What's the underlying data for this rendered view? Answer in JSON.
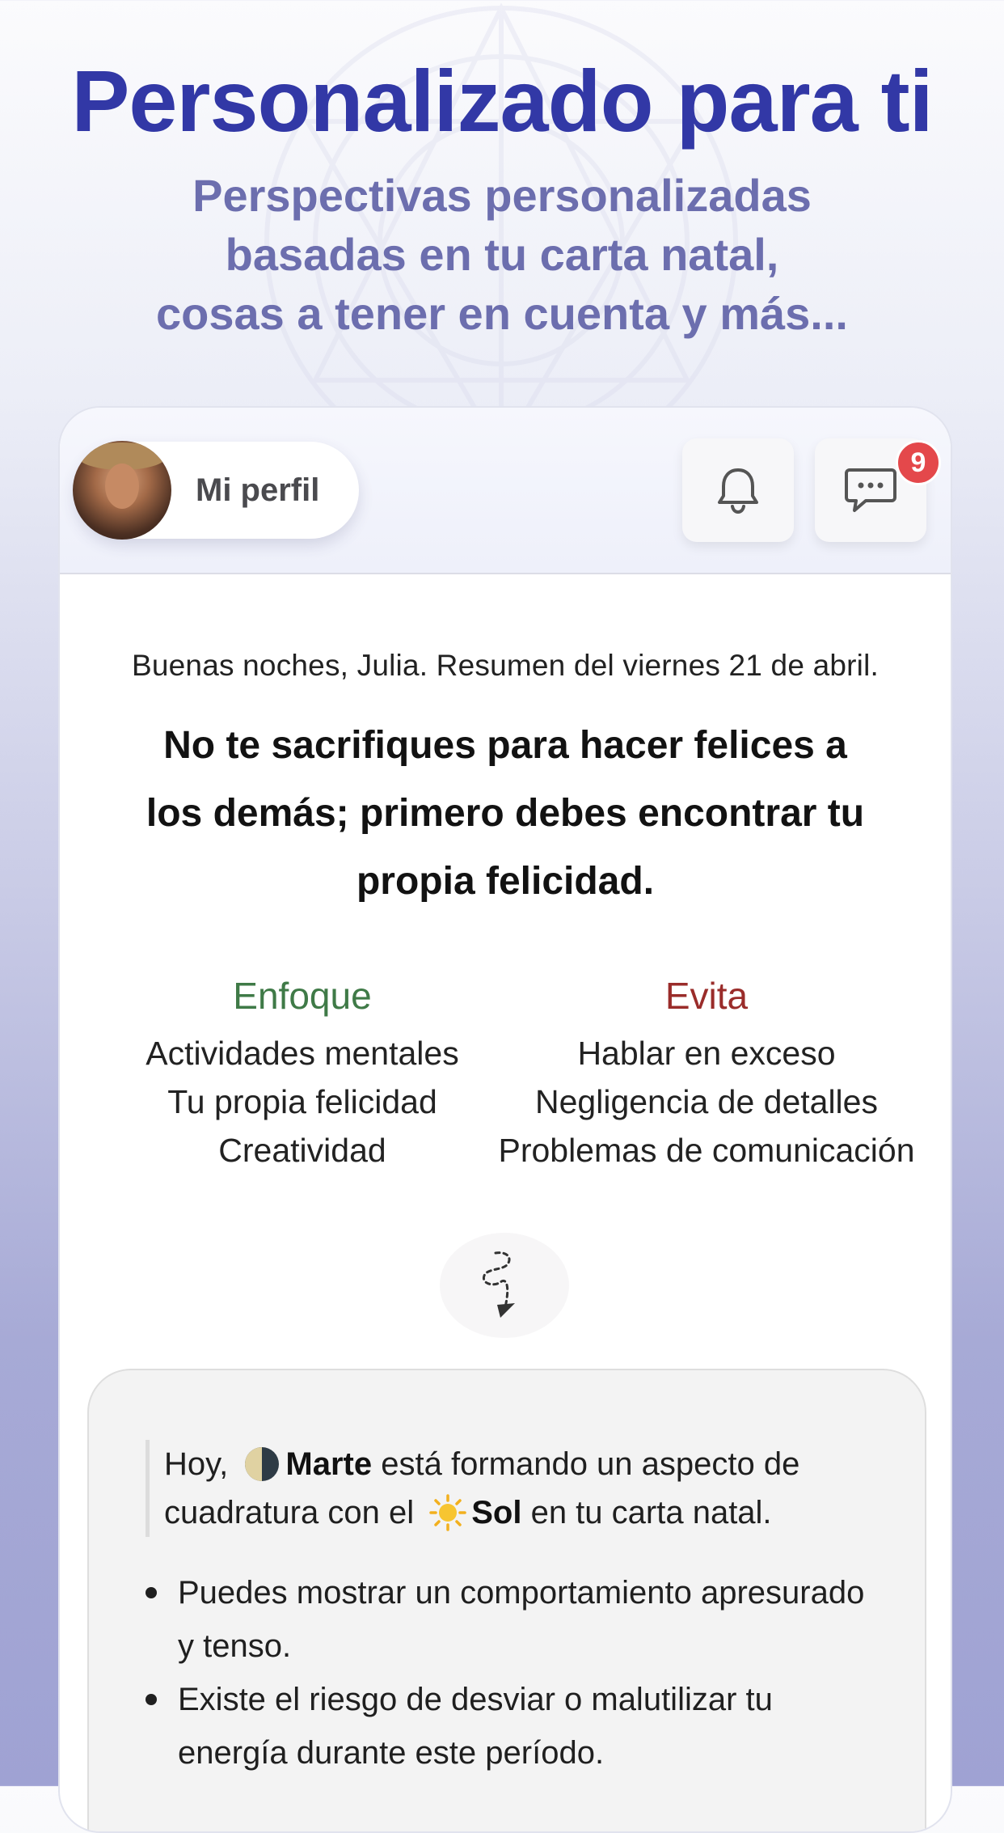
{
  "hero": {
    "title": "Personalizado para ti",
    "subtitle_lines": [
      "Perspectivas personalizadas",
      "basadas en tu carta natal,",
      "cosas a tener en cuenta y más..."
    ]
  },
  "header": {
    "profile_label": "Mi perfil",
    "notifications_icon": "bell-icon",
    "messages_icon": "chat-bubble-icon",
    "messages_badge": "9"
  },
  "summary": {
    "greeting": "Buenas noches, Julia. Resumen del viernes 21 de abril.",
    "quote_lines": [
      "No te sacrifiques para hacer felices a",
      "los demás; primero debes encontrar tu",
      "propia felicidad."
    ]
  },
  "focus": {
    "title": "Enfoque",
    "items": [
      "Actividades mentales",
      "Tu propia felicidad",
      "Creatividad"
    ]
  },
  "avoid": {
    "title": "Evita",
    "items": [
      "Hablar en exceso",
      "Negligencia de detalles",
      "Problemas de comunicación"
    ]
  },
  "insight": {
    "lead_prefix": "Hoy,",
    "planet1": "Marte",
    "lead_middle": "está formando un aspecto de cuadratura con el",
    "planet2": "Sol",
    "lead_suffix": "en tu carta natal.",
    "bullets": [
      "Puedes mostrar un comportamiento apresurado y tenso.",
      "Existe el riesgo de desviar o malutilizar tu energía durante este período."
    ]
  },
  "colors": {
    "title": "#3238a6",
    "subtitle": "#6c6eae",
    "focus": "#3f7a47",
    "avoid": "#9a2c2a",
    "badge": "#e4484b"
  }
}
